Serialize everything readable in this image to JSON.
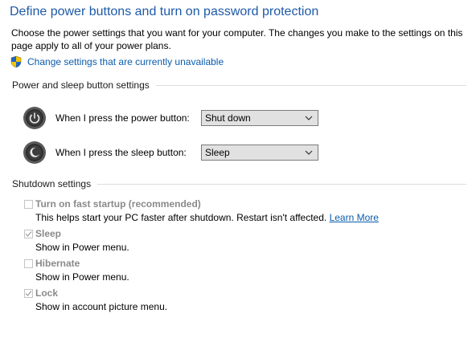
{
  "page": {
    "title": "Define power buttons and turn on password protection",
    "intro": "Choose the power settings that you want for your computer. The changes you make to the settings on this page apply to all of your power plans.",
    "change_link": "Change settings that are currently unavailable"
  },
  "power_section": {
    "heading": "Power and sleep button settings",
    "power_button": {
      "label": "When I press the power button:",
      "value": "Shut down",
      "icon": "power-icon"
    },
    "sleep_button": {
      "label": "When I press the sleep button:",
      "value": "Sleep",
      "icon": "sleep-icon"
    }
  },
  "shutdown_section": {
    "heading": "Shutdown settings",
    "options": [
      {
        "label": "Turn on fast startup (recommended)",
        "checked": false,
        "desc": "This helps start your PC faster after shutdown. Restart isn't affected.",
        "link": "Learn More"
      },
      {
        "label": "Sleep",
        "checked": true,
        "desc": "Show in Power menu."
      },
      {
        "label": "Hibernate",
        "checked": false,
        "desc": "Show in Power menu."
      },
      {
        "label": "Lock",
        "checked": true,
        "desc": "Show in account picture menu."
      }
    ]
  },
  "colors": {
    "title": "#1e5aa8",
    "link": "#0b5cad",
    "disabled_text": "#8a8a8a"
  }
}
